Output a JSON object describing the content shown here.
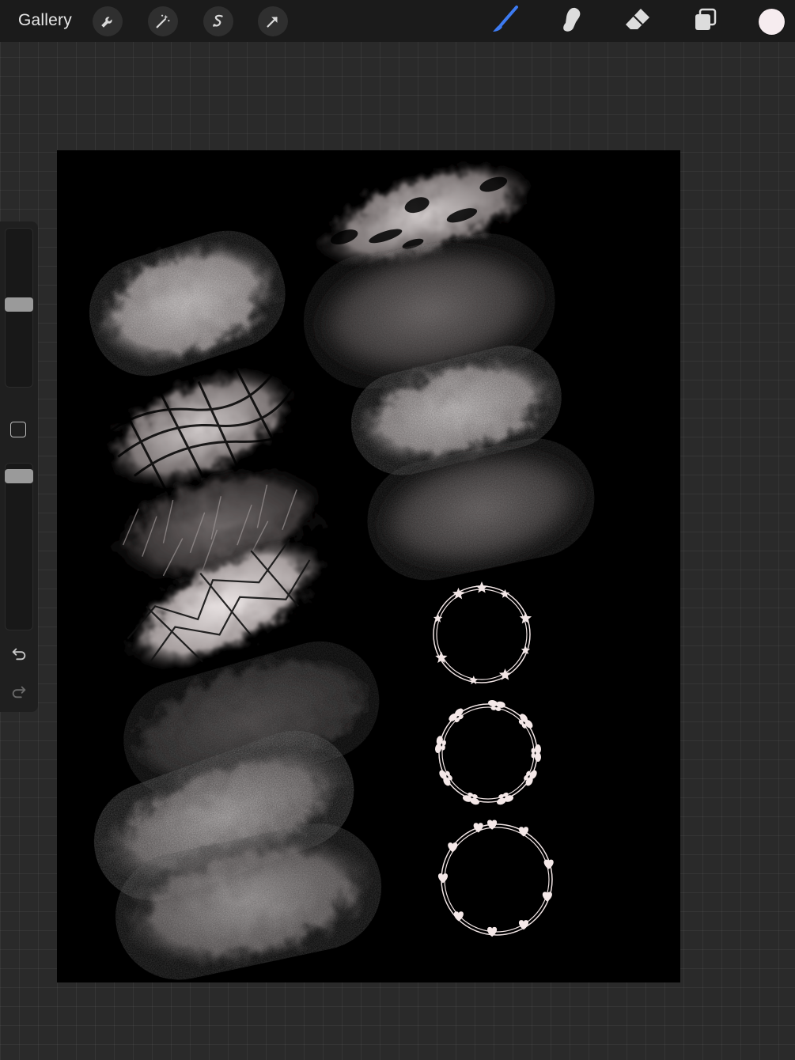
{
  "toolbar": {
    "gallery_label": "Gallery",
    "left_tools": [
      "wrench-icon",
      "magic-wand-icon",
      "selection-icon",
      "transform-arrow-icon"
    ],
    "right_tools": [
      "brush-icon",
      "smudge-icon",
      "eraser-icon",
      "layers-icon"
    ],
    "active_tool": "brush",
    "accent_color": "#3d7bf2",
    "current_color": "#f6ecef"
  },
  "sidebar": {
    "brush_size_level": 0.52,
    "opacity_level": 0.96,
    "items": [
      "brush-size-slider",
      "modify-button",
      "opacity-slider",
      "undo-icon",
      "redo-icon"
    ]
  },
  "canvas": {
    "background": "#000000",
    "content": [
      "texture-brush-strokes",
      "star-wreath",
      "butterfly-wreath",
      "heart-wreath"
    ]
  }
}
